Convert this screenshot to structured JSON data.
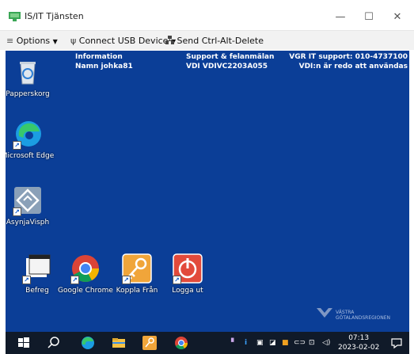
{
  "window": {
    "title": "IS/IT Tjänsten",
    "minimize_glyph": "—",
    "maximize_glyph": "☐",
    "close_glyph": "✕"
  },
  "toolbar": {
    "options": "Options",
    "connect_usb": "Connect USB Device",
    "send_cad": "Send Ctrl-Alt-Delete"
  },
  "info": {
    "col1_line1": "Information",
    "col1_line2": "Namn  johka81",
    "col2_line1": "Support & felanmälan",
    "col2_line2": "VDI  VDIVC2203A055",
    "col3_line1": "VGR IT support: 010-4737100",
    "col3_line2": "VDI:n är redo att användas"
  },
  "desktop_icons": {
    "recycle": "Papperskorg",
    "edge": "Microsoft Edge",
    "asynja": "AsynjaVisph",
    "befreg": "Befreg",
    "chrome": "Google Chrome",
    "koppla": "Koppla Från",
    "logga": "Logga ut"
  },
  "watermark": {
    "line1": "VÄSTRA",
    "line2": "GÖTALANDSREGIONEN"
  },
  "taskbar": {
    "time": "07:13",
    "date": "2023-02-02"
  },
  "colors": {
    "desktop_bg": "#0b3e97",
    "taskbar_bg": "#101a29"
  }
}
